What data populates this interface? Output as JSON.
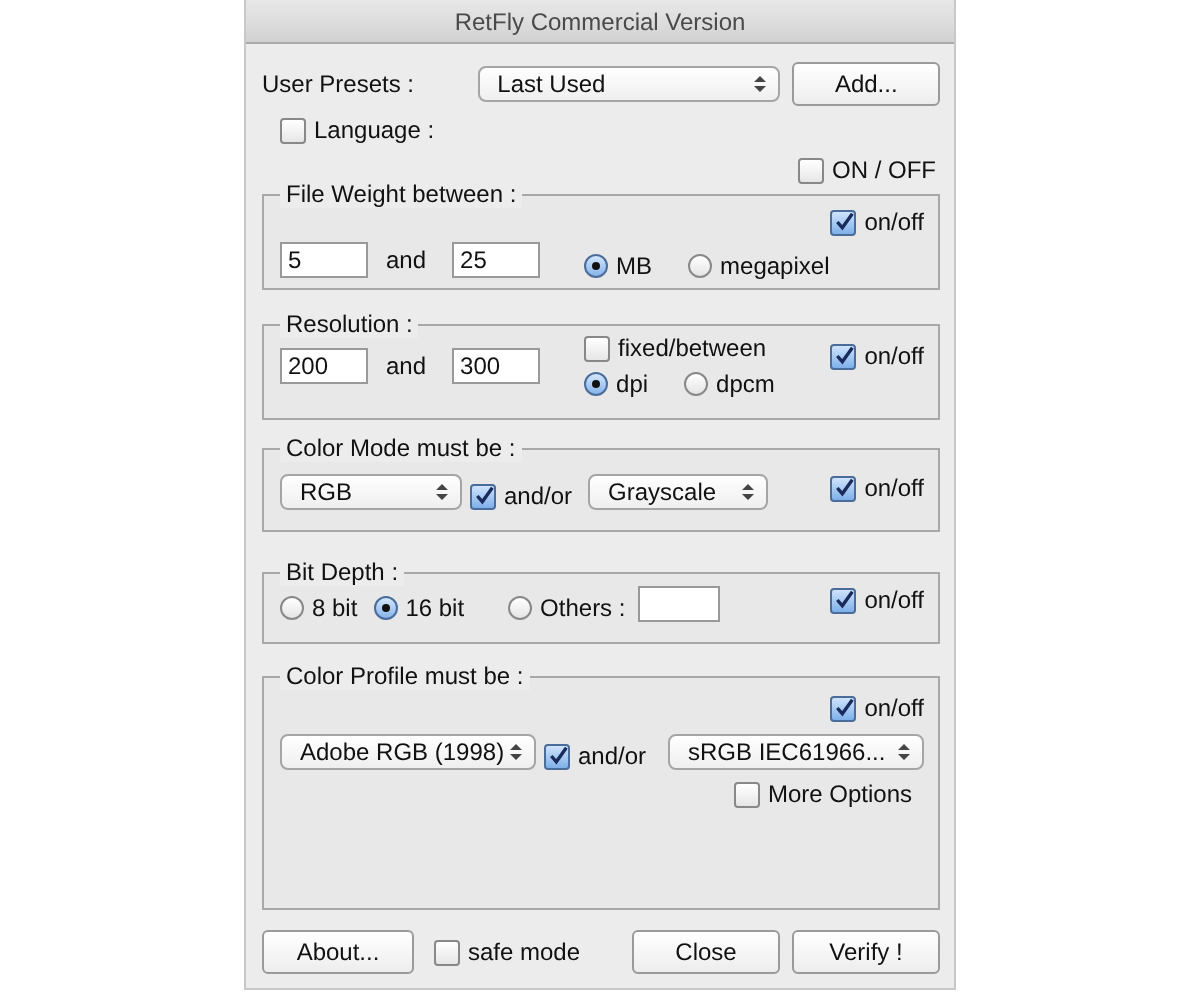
{
  "window": {
    "title": "RetFly Commercial Version"
  },
  "presets": {
    "label": "User Presets :",
    "value": "Last Used",
    "button": "Add..."
  },
  "language": {
    "label": "Language :",
    "checked": false
  },
  "master": {
    "label": "ON / OFF",
    "checked": false
  },
  "groups": [
    {
      "kind": "range",
      "title": "File Weight between :",
      "toggle": {
        "label": "on/off",
        "checked": true
      },
      "min": "5",
      "joiner": "and",
      "max": "25",
      "options": [
        {
          "label": "MB",
          "selected": true
        },
        {
          "label": "megapixel",
          "selected": false
        }
      ]
    },
    {
      "kind": "range",
      "title": "Resolution :",
      "toggle": {
        "label": "on/off",
        "checked": true
      },
      "min": "200",
      "joiner": "and",
      "max": "300",
      "mode": {
        "label": "fixed/between",
        "checked": false
      },
      "options": [
        {
          "label": "dpi",
          "selected": true
        },
        {
          "label": "dpcm",
          "selected": false
        }
      ]
    },
    {
      "kind": "pair",
      "title": "Color Mode must be :",
      "toggle": {
        "label": "on/off",
        "checked": true
      },
      "first": "RGB",
      "joiner": {
        "label": "and/or",
        "checked": true
      },
      "second": "Grayscale"
    },
    {
      "kind": "radios",
      "title": "Bit Depth :",
      "toggle": {
        "label": "on/off",
        "checked": true
      },
      "options": [
        {
          "label": "8 bit",
          "selected": false
        },
        {
          "label": "16 bit",
          "selected": true
        },
        {
          "label": "Others :",
          "selected": false
        }
      ]
    },
    {
      "kind": "pair",
      "title": "Color Profile must be :",
      "toggle": {
        "label": "on/off",
        "checked": true
      },
      "first": "Adobe RGB (1998)",
      "joiner": {
        "label": "and/or",
        "checked": true
      },
      "second": "sRGB IEC61966...",
      "more": {
        "label": "More Options",
        "checked": false
      }
    }
  ],
  "footer": {
    "about": "About...",
    "safe_mode": {
      "label": "safe mode",
      "checked": false
    },
    "close": "Close",
    "verify": "Verify !"
  }
}
